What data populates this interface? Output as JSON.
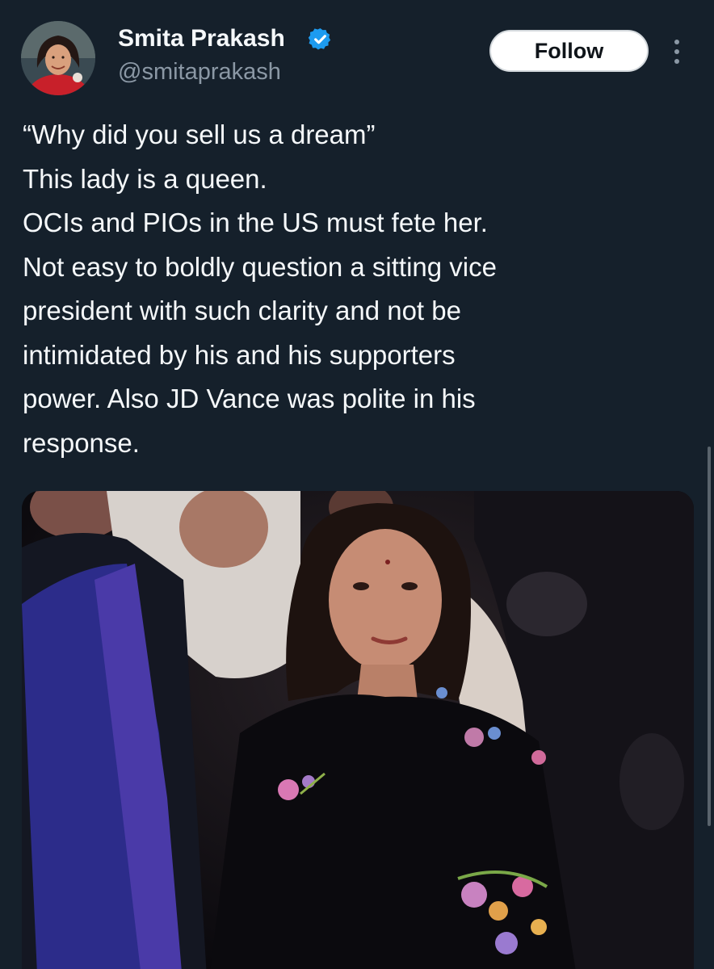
{
  "tweet": {
    "author": {
      "display_name": "Smita Prakash",
      "handle": "@smitaprakash",
      "verified": true,
      "avatar_icon": "profile-photo-avatar"
    },
    "follow_label": "Follow",
    "more_icon": "vertical-dots-icon",
    "text_lines": [
      "“Why did you sell us a dream”",
      "This lady is a queen.",
      "OCIs and PIOs in the US must fete her.",
      "Not easy to boldly question a sitting vice",
      "president with such clarity and not be",
      "intimidated by his and his supporters",
      "power. Also JD Vance was polite in his",
      "response."
    ],
    "media": {
      "kind": "photo"
    }
  },
  "colors": {
    "background": "#15202b",
    "text_primary": "#f5f8fa",
    "text_secondary": "#8b98a5",
    "verified_badge": "#1d9bf0",
    "follow_button_bg": "#ffffff",
    "follow_button_text": "#0f1419"
  }
}
